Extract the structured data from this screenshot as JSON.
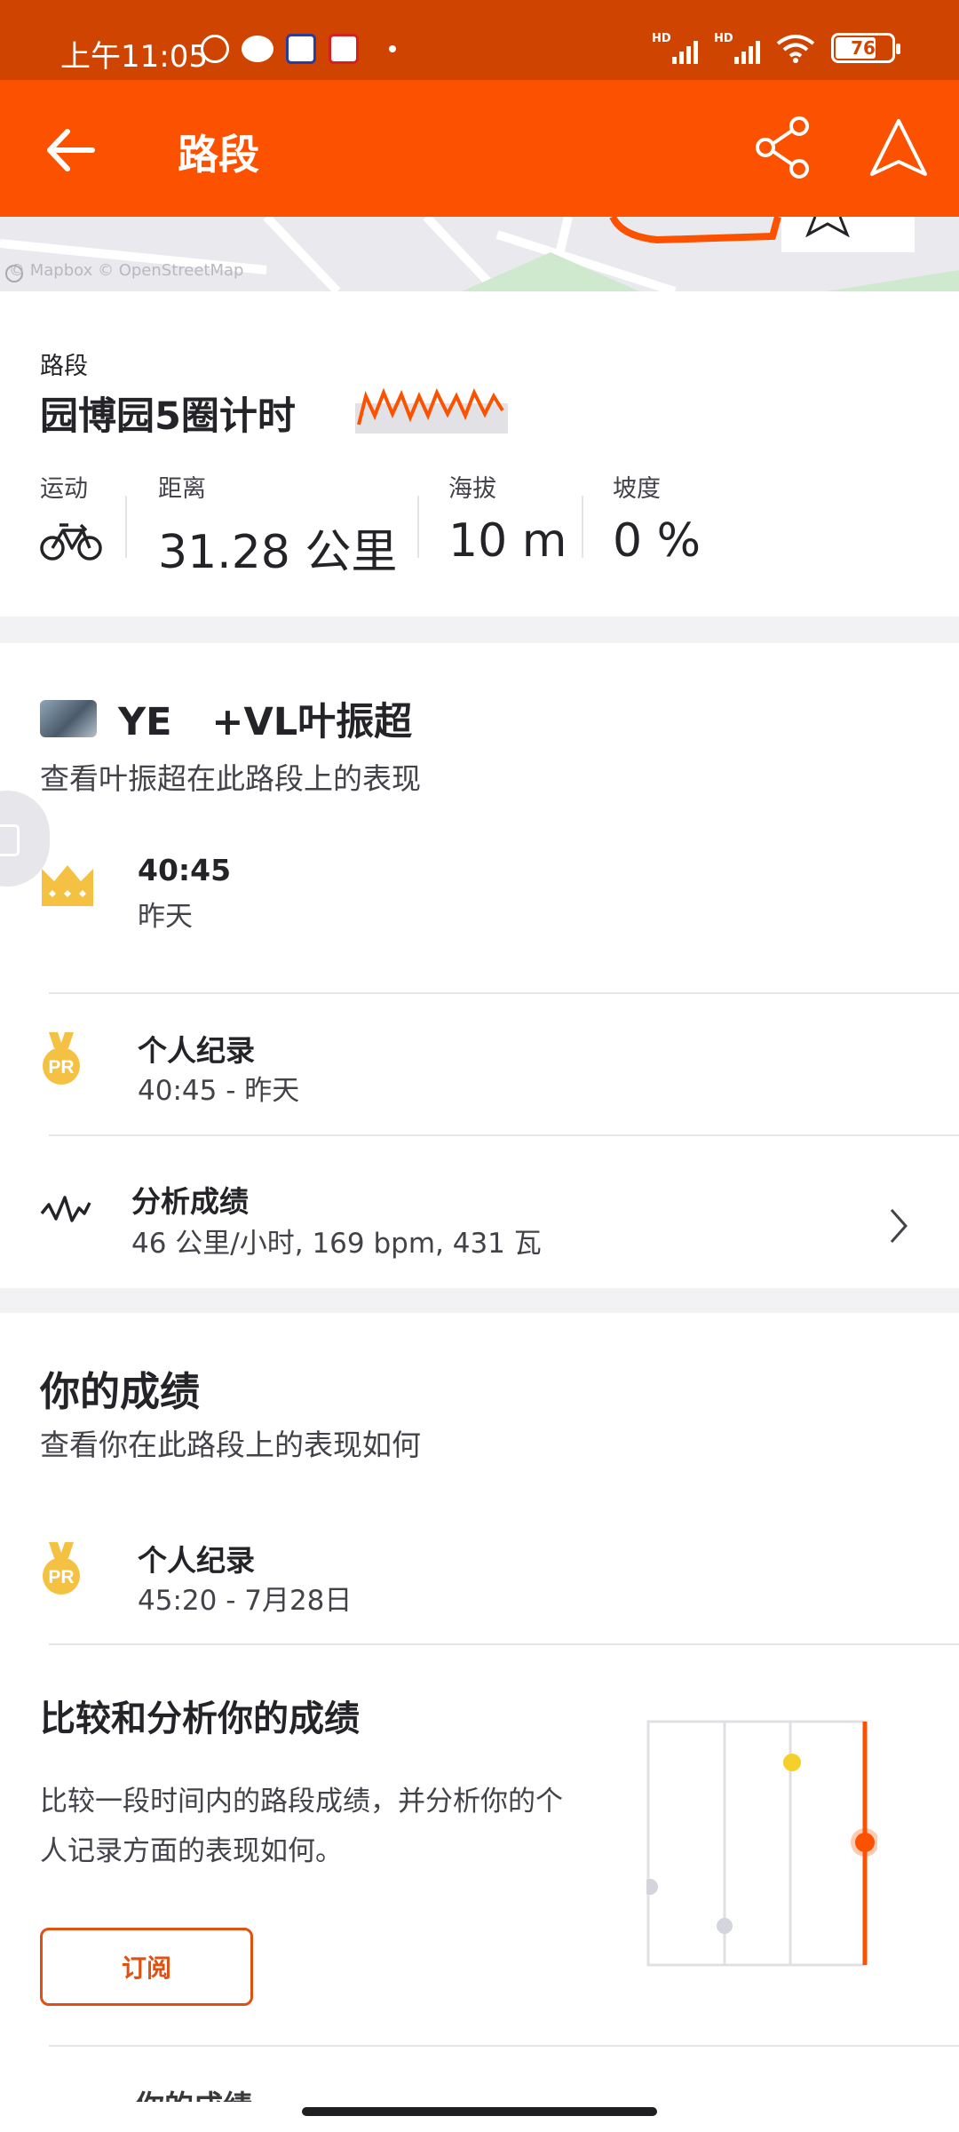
{
  "status_bar": {
    "time": "上午11:05",
    "battery": "76",
    "network_label": "HD"
  },
  "app_bar": {
    "title": "路段",
    "back_icon": "arrow-left-icon",
    "share_icon": "share-icon",
    "navigate_icon": "navigation-arrow-icon"
  },
  "map": {
    "attribution": "© Mapbox © OpenStreetMap"
  },
  "segment": {
    "kicker": "路段",
    "name": "园博园5圈计时",
    "stats": [
      {
        "label": "运动",
        "icon": "bicycle-icon"
      },
      {
        "label": "距离",
        "value": "31.28 公里"
      },
      {
        "label": "海拔",
        "value": "10 m"
      },
      {
        "label": "坡度",
        "value": "0 %"
      }
    ]
  },
  "leader": {
    "name": "YE   +VL叶振超",
    "subtitle": "查看叶振超在此路段上的表现",
    "kom": {
      "time": "40:45",
      "date": "昨天",
      "icon": "crown-icon"
    },
    "pr": {
      "title": "个人纪录",
      "detail": "40:45 - 昨天",
      "icon": "pr-medal-icon"
    },
    "analysis": {
      "title": "分析成绩",
      "detail": "46 公里/小时, 169 bpm, 431 瓦",
      "icon": "analysis-wave-icon"
    }
  },
  "you": {
    "title": "你的成绩",
    "subtitle": "查看你在此路段上的表现如何",
    "pr": {
      "title": "个人纪录",
      "detail": "45:20 - 7月28日",
      "icon": "pr-medal-icon"
    },
    "compare_title": "比较和分析你的成绩",
    "compare_body": "比较一段时间内的路段成绩，并分析你的个人记录方面的表现如何。",
    "subscribe_label": "订阅",
    "peek_title": "你的成绩"
  },
  "colors": {
    "brand": "#fc5200",
    "status_bar": "#cf4400",
    "gold": "#f5c142",
    "text": "#242428"
  }
}
